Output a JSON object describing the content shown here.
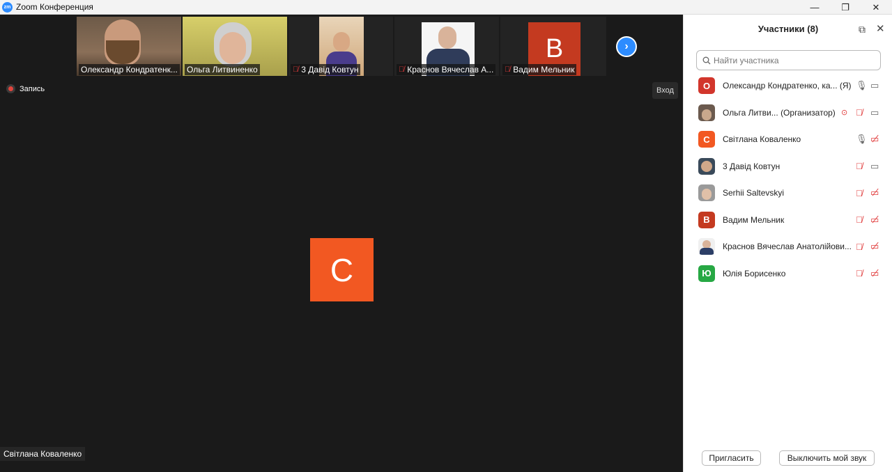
{
  "window": {
    "title": "Zoom Конференция",
    "app_icon_text": "zm",
    "controls": {
      "minimize": "—",
      "restore": "❐",
      "close": "✕"
    }
  },
  "colors": {
    "accent": "#2d8cff",
    "mute_red": "#e03a3a",
    "avatar_orange": "#f25822"
  },
  "gallery": [
    {
      "name": "Олександр Кондратенк...",
      "muted": false,
      "type": "video"
    },
    {
      "name": "Ольга Литвиненко",
      "muted": false,
      "type": "video"
    },
    {
      "name": "3 Давід Ковтун",
      "muted": true,
      "type": "video"
    },
    {
      "name": "Краснов Вячеслав А...",
      "muted": true,
      "type": "photo"
    },
    {
      "name": "Вадим Мельник",
      "muted": true,
      "type": "avatar",
      "initial": "В"
    }
  ],
  "next_page_icon": "›",
  "recording": {
    "label": "Запись"
  },
  "enter_label": "Вход",
  "active_speaker": {
    "initial": "С",
    "name": "Світлана Коваленко"
  },
  "panel": {
    "title": "Участники (8)",
    "popout_icon": "⧉",
    "close_icon": "✕",
    "search_placeholder": "Найти участника",
    "participants": [
      {
        "name": "Олександр Кондратенко, ка...",
        "suffix": "(Я)",
        "avatar": "О",
        "avatar_color": "#d2362c",
        "mic": "on",
        "cam": "on"
      },
      {
        "name": "Ольга Литви... (Организатор)",
        "suffix": "",
        "avatar": "",
        "avatar_color": "#6b5a4e",
        "mic": "off",
        "cam": "on",
        "recording": true
      },
      {
        "name": "Світлана Коваленко",
        "suffix": "",
        "avatar": "С",
        "avatar_color": "#f25822",
        "mic": "on",
        "cam": "off"
      },
      {
        "name": "3 Давід Ковтун",
        "suffix": "",
        "avatar": "",
        "avatar_color": "#3a4a5a",
        "mic": "off",
        "cam": "on"
      },
      {
        "name": "Serhii Saltevskyi",
        "suffix": "",
        "avatar": "",
        "avatar_color": "#9a9a9a",
        "mic": "off",
        "cam": "off"
      },
      {
        "name": "Вадим Мельник",
        "suffix": "",
        "avatar": "В",
        "avatar_color": "#c43a20",
        "mic": "off",
        "cam": "off"
      },
      {
        "name": "Краснов Вячеслав Анатолійови...",
        "suffix": "",
        "avatar": "",
        "avatar_color": "#2c3e66",
        "mic": "off",
        "cam": "off"
      },
      {
        "name": "Юлія Борисенко",
        "suffix": "",
        "avatar": "Ю",
        "avatar_color": "#27a844",
        "mic": "off",
        "cam": "off"
      }
    ],
    "invite_label": "Пригласить",
    "mute_me_label": "Выключить мой звук"
  }
}
